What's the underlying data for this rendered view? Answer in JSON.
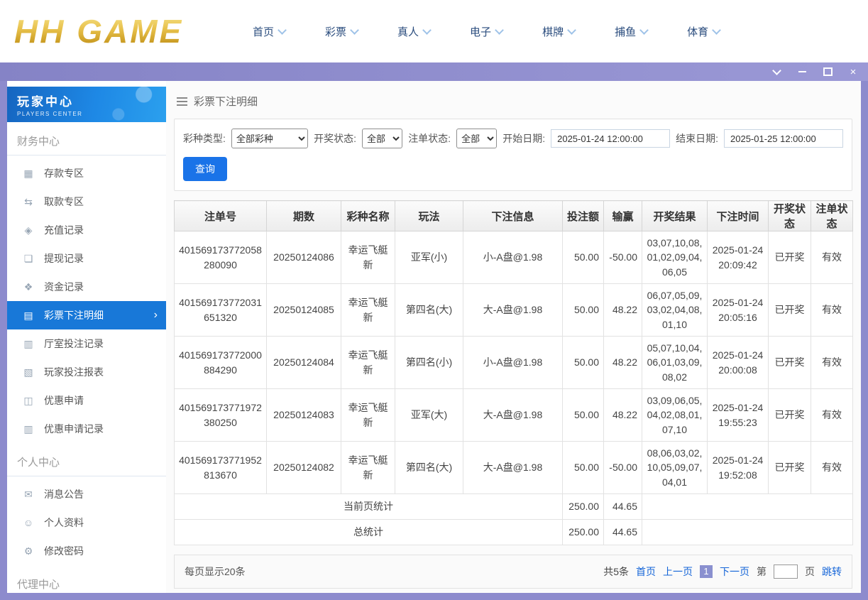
{
  "theme": {
    "accent_blue": "#1a73e8",
    "sidebar_active_blue": "#1878d8",
    "titlebar_purple": "#8d8bcd",
    "brand_gold": "#d4a52a",
    "link_blue": "#1565d8"
  },
  "brand": {
    "logo_text": "HH GAME"
  },
  "top_nav": {
    "items": [
      "首页",
      "彩票",
      "真人",
      "电子",
      "棋牌",
      "捕鱼",
      "体育"
    ]
  },
  "titlebar": {
    "close_glyph": "×"
  },
  "sidebar": {
    "title": "玩家中心",
    "subtitle": "PLAYERS CENTER",
    "sections": [
      {
        "title": "财务中心",
        "items": [
          {
            "label": "存款专区",
            "icon": "deposit-icon",
            "glyph": "▦"
          },
          {
            "label": "取款专区",
            "icon": "withdraw-icon",
            "glyph": "⇆"
          },
          {
            "label": "充值记录",
            "icon": "recharge-record-icon",
            "glyph": "◈"
          },
          {
            "label": "提现记录",
            "icon": "cashout-record-icon",
            "glyph": "❏"
          },
          {
            "label": "资金记录",
            "icon": "funds-record-icon",
            "glyph": "❖"
          },
          {
            "label": "彩票下注明细",
            "icon": "lottery-bet-detail-icon",
            "glyph": "▤",
            "active": true
          },
          {
            "label": "厅室投注记录",
            "icon": "hall-bet-record-icon",
            "glyph": "▥"
          },
          {
            "label": "玩家投注报表",
            "icon": "player-bet-report-icon",
            "glyph": "▧"
          },
          {
            "label": "优惠申请",
            "icon": "promo-apply-icon",
            "glyph": "◫"
          },
          {
            "label": "优惠申请记录",
            "icon": "promo-record-icon",
            "glyph": "▥"
          }
        ]
      },
      {
        "title": "个人中心",
        "items": [
          {
            "label": "消息公告",
            "icon": "messages-icon",
            "glyph": "✉"
          },
          {
            "label": "个人资料",
            "icon": "profile-icon",
            "glyph": "☺"
          },
          {
            "label": "修改密码",
            "icon": "password-icon",
            "glyph": "⚙"
          }
        ]
      },
      {
        "title": "代理中心",
        "items": []
      }
    ]
  },
  "main": {
    "breadcrumb": {
      "title": "彩票下注明细"
    },
    "filters": {
      "lottery_type": {
        "label": "彩种类型:",
        "value": "全部彩种"
      },
      "draw_status": {
        "label": "开奖状态:",
        "value": "全部"
      },
      "order_status": {
        "label": "注单状态:",
        "value": "全部"
      },
      "start_date": {
        "label": "开始日期:",
        "value": "2025-01-24 12:00:00"
      },
      "end_date": {
        "label": "结束日期:",
        "value": "2025-01-25 12:00:00"
      },
      "query_button": "查询"
    },
    "table": {
      "headers": [
        "注单号",
        "期数",
        "彩种名称",
        "玩法",
        "下注信息",
        "投注额",
        "输赢",
        "开奖结果",
        "下注时间",
        "开奖状态",
        "注单状态"
      ],
      "rows": [
        {
          "bet_no": "401569173772058280090",
          "period": "20250124086",
          "lottery": "幸运飞艇新",
          "play": "亚军(小)",
          "bet_info": "小-A盘@1.98",
          "amount": "50.00",
          "winloss": "-50.00",
          "result": "03,07,10,08,01,02,09,04,06,05",
          "time": "2025-01-24 20:09:42",
          "draw_status": "已开奖",
          "order_status": "有效"
        },
        {
          "bet_no": "401569173772031651320",
          "period": "20250124085",
          "lottery": "幸运飞艇新",
          "play": "第四名(大)",
          "bet_info": "大-A盘@1.98",
          "amount": "50.00",
          "winloss": "48.22",
          "result": "06,07,05,09,03,02,04,08,01,10",
          "time": "2025-01-24 20:05:16",
          "draw_status": "已开奖",
          "order_status": "有效"
        },
        {
          "bet_no": "401569173772000884290",
          "period": "20250124084",
          "lottery": "幸运飞艇新",
          "play": "第四名(小)",
          "bet_info": "小-A盘@1.98",
          "amount": "50.00",
          "winloss": "48.22",
          "result": "05,07,10,04,06,01,03,09,08,02",
          "time": "2025-01-24 20:00:08",
          "draw_status": "已开奖",
          "order_status": "有效"
        },
        {
          "bet_no": "401569173771972380250",
          "period": "20250124083",
          "lottery": "幸运飞艇新",
          "play": "亚军(大)",
          "bet_info": "大-A盘@1.98",
          "amount": "50.00",
          "winloss": "48.22",
          "result": "03,09,06,05,04,02,08,01,07,10",
          "time": "2025-01-24 19:55:23",
          "draw_status": "已开奖",
          "order_status": "有效"
        },
        {
          "bet_no": "401569173771952813670",
          "period": "20250124082",
          "lottery": "幸运飞艇新",
          "play": "第四名(大)",
          "bet_info": "大-A盘@1.98",
          "amount": "50.00",
          "winloss": "-50.00",
          "result": "08,06,03,02,10,05,09,07,04,01",
          "time": "2025-01-24 19:52:08",
          "draw_status": "已开奖",
          "order_status": "有效"
        }
      ],
      "summary_rows": [
        {
          "label": "当前页统计",
          "amount": "250.00",
          "winloss": "44.65"
        },
        {
          "label": "总统计",
          "amount": "250.00",
          "winloss": "44.65"
        }
      ]
    },
    "pagination": {
      "page_size_text": "每页显示20条",
      "total_text": "共5条",
      "first": "首页",
      "prev": "上一页",
      "current_page": "1",
      "next": "下一页",
      "jump_label_before": "第",
      "jump_label_after": "页",
      "jump_action": "跳转"
    }
  }
}
